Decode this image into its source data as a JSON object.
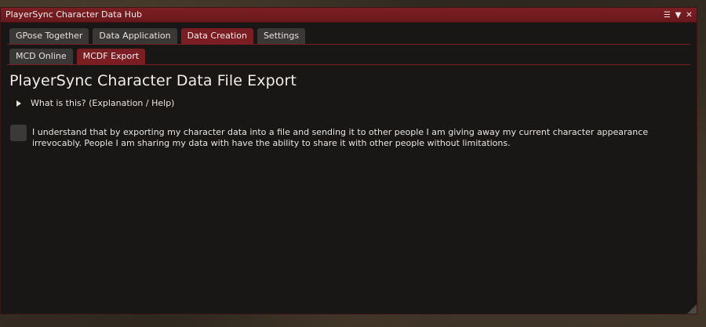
{
  "window": {
    "title": "PlayerSync Character Data Hub",
    "controls": [
      "menu-icon",
      "collapse-icon",
      "close-icon"
    ]
  },
  "tabs": [
    {
      "label": "GPose Together",
      "active": false
    },
    {
      "label": "Data Application",
      "active": false
    },
    {
      "label": "Data Creation",
      "active": true
    },
    {
      "label": "Settings",
      "active": false
    }
  ],
  "subtabs": [
    {
      "label": "MCD Online",
      "active": false
    },
    {
      "label": "MCDF Export",
      "active": true
    }
  ],
  "main": {
    "heading": "PlayerSync Character Data File Export",
    "help_toggle": "What is this? (Explanation / Help)",
    "consent_text": "I understand that by exporting my character data into a file and sending it to other people I am giving away my current character appearance irrevocably. People I am sharing my data with have the ability to share it with other people without limitations.",
    "consent_checked": false
  },
  "colors": {
    "accent": "#7a1e23",
    "tab_inactive": "#3a3837",
    "window_bg": "#181716"
  }
}
